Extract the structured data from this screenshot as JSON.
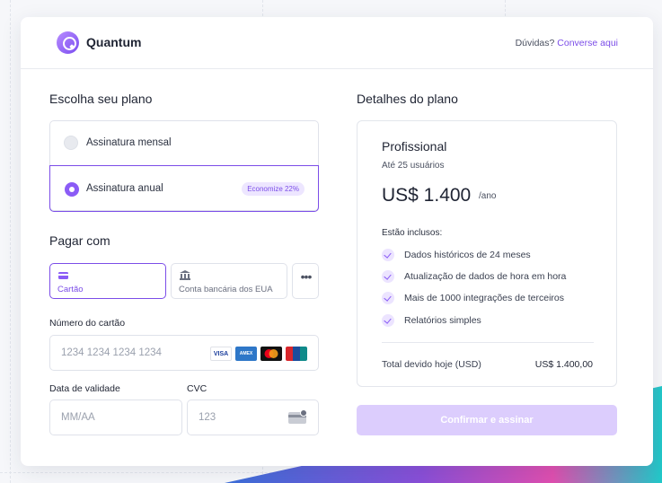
{
  "brand": {
    "name": "Quantum",
    "logo_icon": "quantum-logo-icon"
  },
  "header": {
    "help_prefix": "Dúvidas?",
    "help_link": "Converse aqui"
  },
  "plan_section": {
    "title": "Escolha seu plano",
    "options": [
      {
        "label": "Assinatura mensal",
        "selected": false
      },
      {
        "label": "Assinatura anual",
        "selected": true,
        "badge": "Economize 22%"
      }
    ]
  },
  "payment_section": {
    "title": "Pagar com",
    "methods": [
      {
        "label": "Cartão",
        "icon": "credit-card-icon",
        "selected": true
      },
      {
        "label": "Conta bancária dos EUA",
        "icon": "bank-icon",
        "selected": false
      },
      {
        "label": "•••",
        "icon": "more-dots-icon",
        "selected": false
      }
    ],
    "card_number": {
      "label": "Número do cartão",
      "placeholder": "1234 1234 1234 1234",
      "brands": [
        "VISA",
        "AMEX",
        "Mastercard",
        "UnionPay"
      ]
    },
    "expiry": {
      "label": "Data de validade",
      "placeholder": "MM/AA"
    },
    "cvc": {
      "label": "CVC",
      "placeholder": "123"
    }
  },
  "details": {
    "title": "Detalhes do plano",
    "tier": "Profissional",
    "users": "Até 25 usuários",
    "price": "US$ 1.400",
    "period": "/ano",
    "included_label": "Estão inclusos:",
    "features": [
      "Dados históricos de 24 meses",
      "Atualização de dados de hora em hora",
      "Mais de 1000 integrações de terceiros",
      "Relatórios simples"
    ],
    "total_label": "Total devido hoje (USD)",
    "total_value": "US$ 1.400,00"
  },
  "confirm_button": "Confirmar e assinar",
  "colors": {
    "accent": "#7b4de8",
    "button_disabled": "#dccdfd"
  }
}
